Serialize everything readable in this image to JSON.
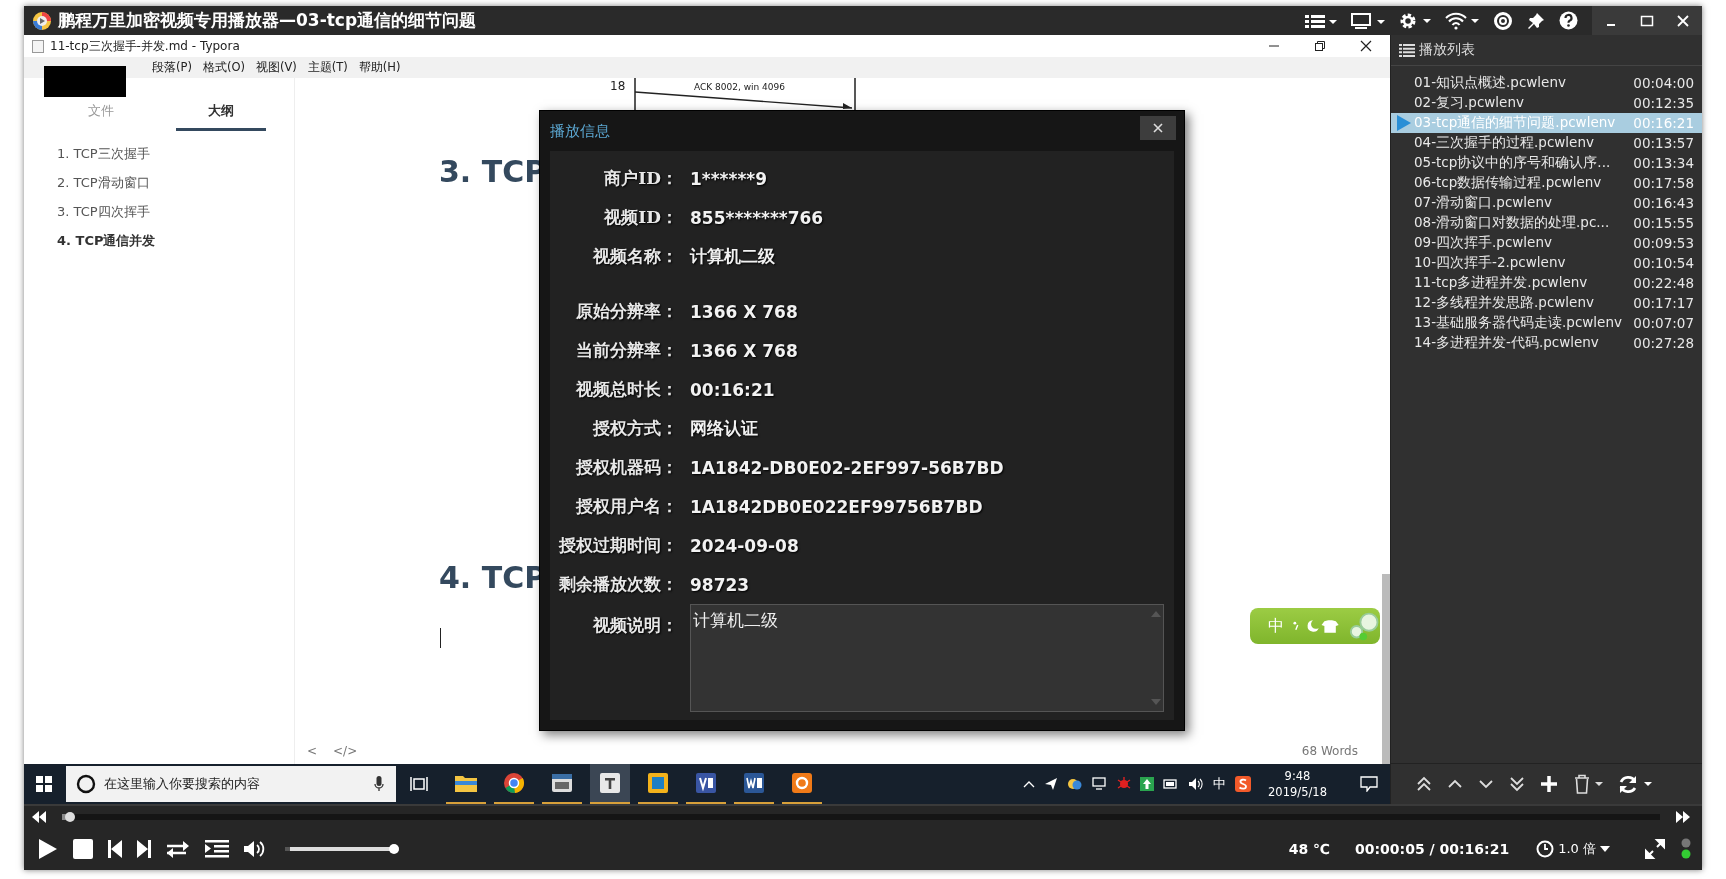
{
  "player": {
    "title": "鹏程万里加密视频专用播放器—03-tcp通信的细节问题"
  },
  "typora": {
    "title": "11-tcp三次握手-并发.md - Typora",
    "menu": [
      "段落(P)",
      "格式(O)",
      "视图(V)",
      "主题(T)",
      "帮助(H)"
    ],
    "sidebar_tabs": [
      {
        "label": "文件",
        "selected": false
      },
      {
        "label": "大纲",
        "selected": true
      }
    ],
    "outline": [
      {
        "label": "1. TCP三次握手",
        "selected": false
      },
      {
        "label": "2. TCP滑动窗口",
        "selected": false
      },
      {
        "label": "3. TCP四次挥手",
        "selected": false
      },
      {
        "label": "4. TCP通信并发",
        "selected": true
      }
    ],
    "diagram": {
      "row_number": "18",
      "arrow_label": "ACK 8002, win 4096"
    },
    "headings": [
      "3. TCP",
      "4. TCP"
    ],
    "footer_buttons": [
      "<",
      "</>"
    ],
    "word_count": "68 Words"
  },
  "ime_bar": {
    "label": "中"
  },
  "taskbar": {
    "search_placeholder": "在这里输入你要搜索的内容",
    "tray_input": "中",
    "time": "9:48",
    "date": "2019/5/18"
  },
  "dialog": {
    "title": "播放信息",
    "sections": [
      {
        "fields": [
          {
            "label": "商户ID：",
            "value": "1******9"
          },
          {
            "label": "视频ID：",
            "value": "855*******766"
          },
          {
            "label": "视频名称：",
            "value": "计算机二级"
          }
        ]
      },
      {
        "fields": [
          {
            "label": "原始分辨率：",
            "value": "1366 X 768"
          },
          {
            "label": "当前分辨率：",
            "value": "1366 X 768"
          },
          {
            "label": "视频总时长：",
            "value": "00:16:21"
          },
          {
            "label": "授权方式：",
            "value": "网络认证"
          },
          {
            "label": "授权机器码：",
            "value": "1A1842-DB0E02-2EF997-56B7BD"
          },
          {
            "label": "授权用户名：",
            "value": "1A1842DB0E022EF99756B7BD"
          },
          {
            "label": "授权过期时间：",
            "value": "2024-09-08"
          },
          {
            "label": "剩余播放次数：",
            "value": "98723"
          }
        ]
      }
    ],
    "description": {
      "label": "视频说明：",
      "value": "计算机二级"
    }
  },
  "playlist": {
    "title": "播放列表",
    "items": [
      {
        "name": "01-知识点概述.pcwlenv",
        "duration": "00:04:00",
        "selected": false
      },
      {
        "name": "02-复习.pcwlenv",
        "duration": "00:12:35",
        "selected": false
      },
      {
        "name": "03-tcp通信的细节问题.pcwlenv",
        "duration": "00:16:21",
        "selected": true
      },
      {
        "name": "04-三次握手的过程.pcwlenv",
        "duration": "00:13:57",
        "selected": false
      },
      {
        "name": "05-tcp协议中的序号和确认序...",
        "duration": "00:13:34",
        "selected": false
      },
      {
        "name": "06-tcp数据传输过程.pcwlenv",
        "duration": "00:17:58",
        "selected": false
      },
      {
        "name": "07-滑动窗口.pcwlenv",
        "duration": "00:16:43",
        "selected": false
      },
      {
        "name": "08-滑动窗口对数据的处理.pc...",
        "duration": "00:15:55",
        "selected": false
      },
      {
        "name": "09-四次挥手.pcwlenv",
        "duration": "00:09:53",
        "selected": false
      },
      {
        "name": "10-四次挥手-2.pcwlenv",
        "duration": "00:10:54",
        "selected": false
      },
      {
        "name": "11-tcp多进程并发.pcwlenv",
        "duration": "00:22:48",
        "selected": false
      },
      {
        "name": "12-多线程并发思路.pcwlenv",
        "duration": "00:17:17",
        "selected": false
      },
      {
        "name": "13-基础服务器代码走读.pcwlenv",
        "duration": "00:07:07",
        "selected": false
      },
      {
        "name": "14-多进程并发-代码.pcwlenv",
        "duration": "00:27:28",
        "selected": false
      }
    ]
  },
  "controls": {
    "seek": {
      "level": 0.005
    },
    "volume": {
      "level": 1
    },
    "temperature": "48 ℃",
    "time": "00:00:05 / 00:16:21",
    "speed": "1.0 倍"
  }
}
